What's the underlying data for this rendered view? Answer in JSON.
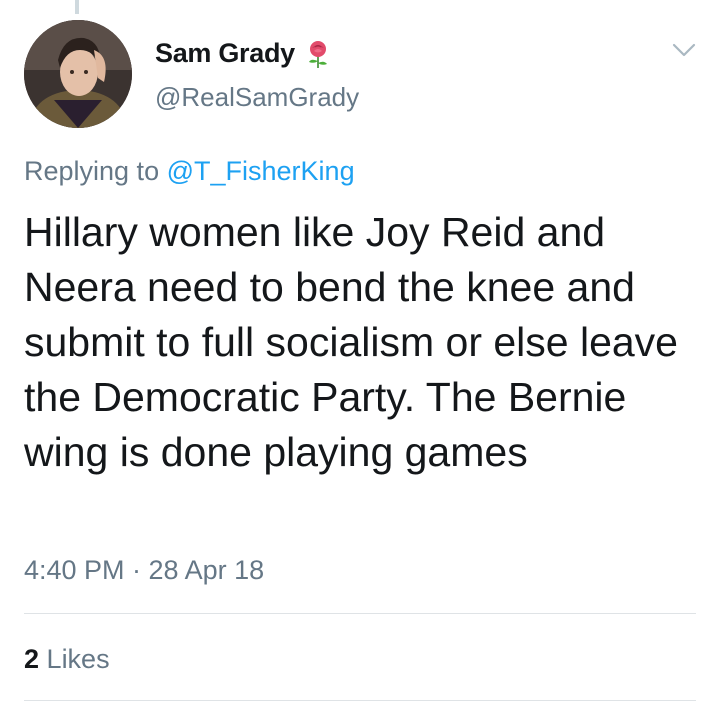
{
  "tweet": {
    "author": {
      "display_name": "Sam Grady",
      "handle": "@RealSamGrady",
      "name_emoji_icon": "rose-icon",
      "avatar_icon": "avatar"
    },
    "reply": {
      "prefix": "Replying to",
      "mention": "@T_FisherKing"
    },
    "text": "Hillary women like Joy Reid and Neera need to bend the knee and submit to full socialism or else leave the Democratic Party. The Bernie wing is done playing games",
    "timestamp": "4:40 PM · 28 Apr 18",
    "likes": {
      "count": "2",
      "label": "Likes"
    }
  },
  "colors": {
    "text_primary": "#14171a",
    "text_secondary": "#657786",
    "link": "#1da1f2",
    "divider": "#dfe3e6"
  },
  "icons": [
    "rose-icon",
    "chevron-down-icon"
  ]
}
